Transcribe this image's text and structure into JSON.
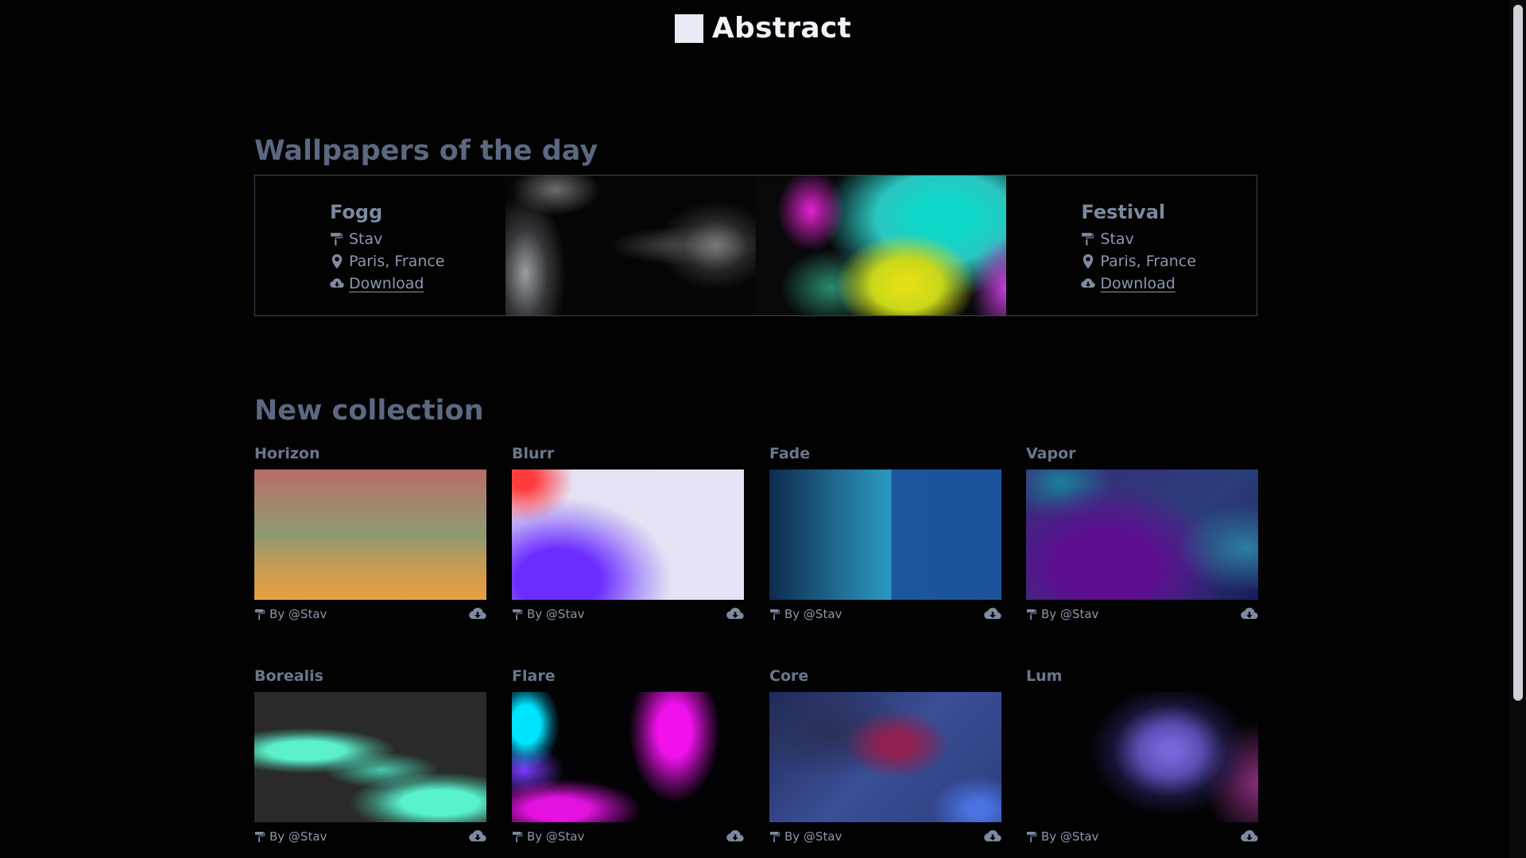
{
  "brand": {
    "name": "Abstract"
  },
  "daily": {
    "title": "Wallpapers of the day",
    "left": {
      "name": "Fogg",
      "author": "Stav",
      "location": "Paris, France",
      "download": "Download"
    },
    "right": {
      "name": "Festival",
      "author": "Stav",
      "location": "Paris, France",
      "download": "Download"
    }
  },
  "collection": {
    "title": "New collection",
    "items": [
      {
        "name": "Horizon",
        "by": "By @Stav"
      },
      {
        "name": "Blurr",
        "by": "By @Stav"
      },
      {
        "name": "Fade",
        "by": "By @Stav"
      },
      {
        "name": "Vapor",
        "by": "By @Stav"
      },
      {
        "name": "Borealis",
        "by": "By @Stav"
      },
      {
        "name": "Flare",
        "by": "By @Stav"
      },
      {
        "name": "Core",
        "by": "By @Stav"
      },
      {
        "name": "Lum",
        "by": "By @Stav"
      }
    ]
  },
  "icons": {
    "author": "paint-roller-icon",
    "location": "map-pin-icon",
    "download": "cloud-download-icon"
  },
  "colors": {
    "background": "#020203",
    "heading": "#5b6880",
    "text": "#8c97ad",
    "border": "#3b4253"
  }
}
